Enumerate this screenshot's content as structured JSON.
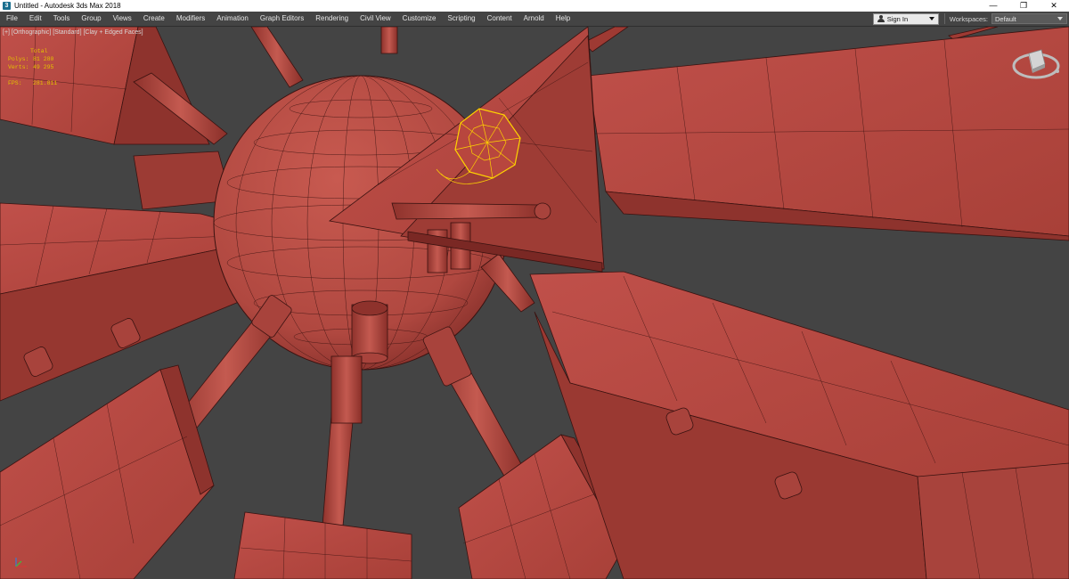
{
  "window": {
    "app_icon": "3",
    "title": "Untitled - Autodesk 3ds Max 2018",
    "minimize": "—",
    "restore": "❐",
    "close": "✕"
  },
  "menu": {
    "items": [
      "File",
      "Edit",
      "Tools",
      "Group",
      "Views",
      "Create",
      "Modifiers",
      "Animation",
      "Graph Editors",
      "Rendering",
      "Civil View",
      "Customize",
      "Scripting",
      "Content",
      "Arnold",
      "Help"
    ],
    "sign_in": "Sign In",
    "workspaces_label": "Workspaces:",
    "workspace_value": "Default"
  },
  "viewport": {
    "label": "[+] [Orthographic] [Standard] [Clay + Edged Faces]",
    "stats": {
      "total": "Total",
      "polys_key": "Polys:",
      "polys_value": "81 280",
      "verts_key": "Verts:",
      "verts_value": "49 295",
      "fps_key": "FPS:",
      "fps_value": "281.811"
    }
  },
  "colors": {
    "viewport_bg": "#444444",
    "clay": "#b84a42",
    "clay_dark": "#8a302b",
    "wire": "#3a1210",
    "selection": "#ffd400"
  },
  "icons": {
    "app": "3ds-max-app-icon",
    "user": "user-icon",
    "viewcube": "viewcube-icon",
    "axis": "axis-tripod-icon"
  }
}
